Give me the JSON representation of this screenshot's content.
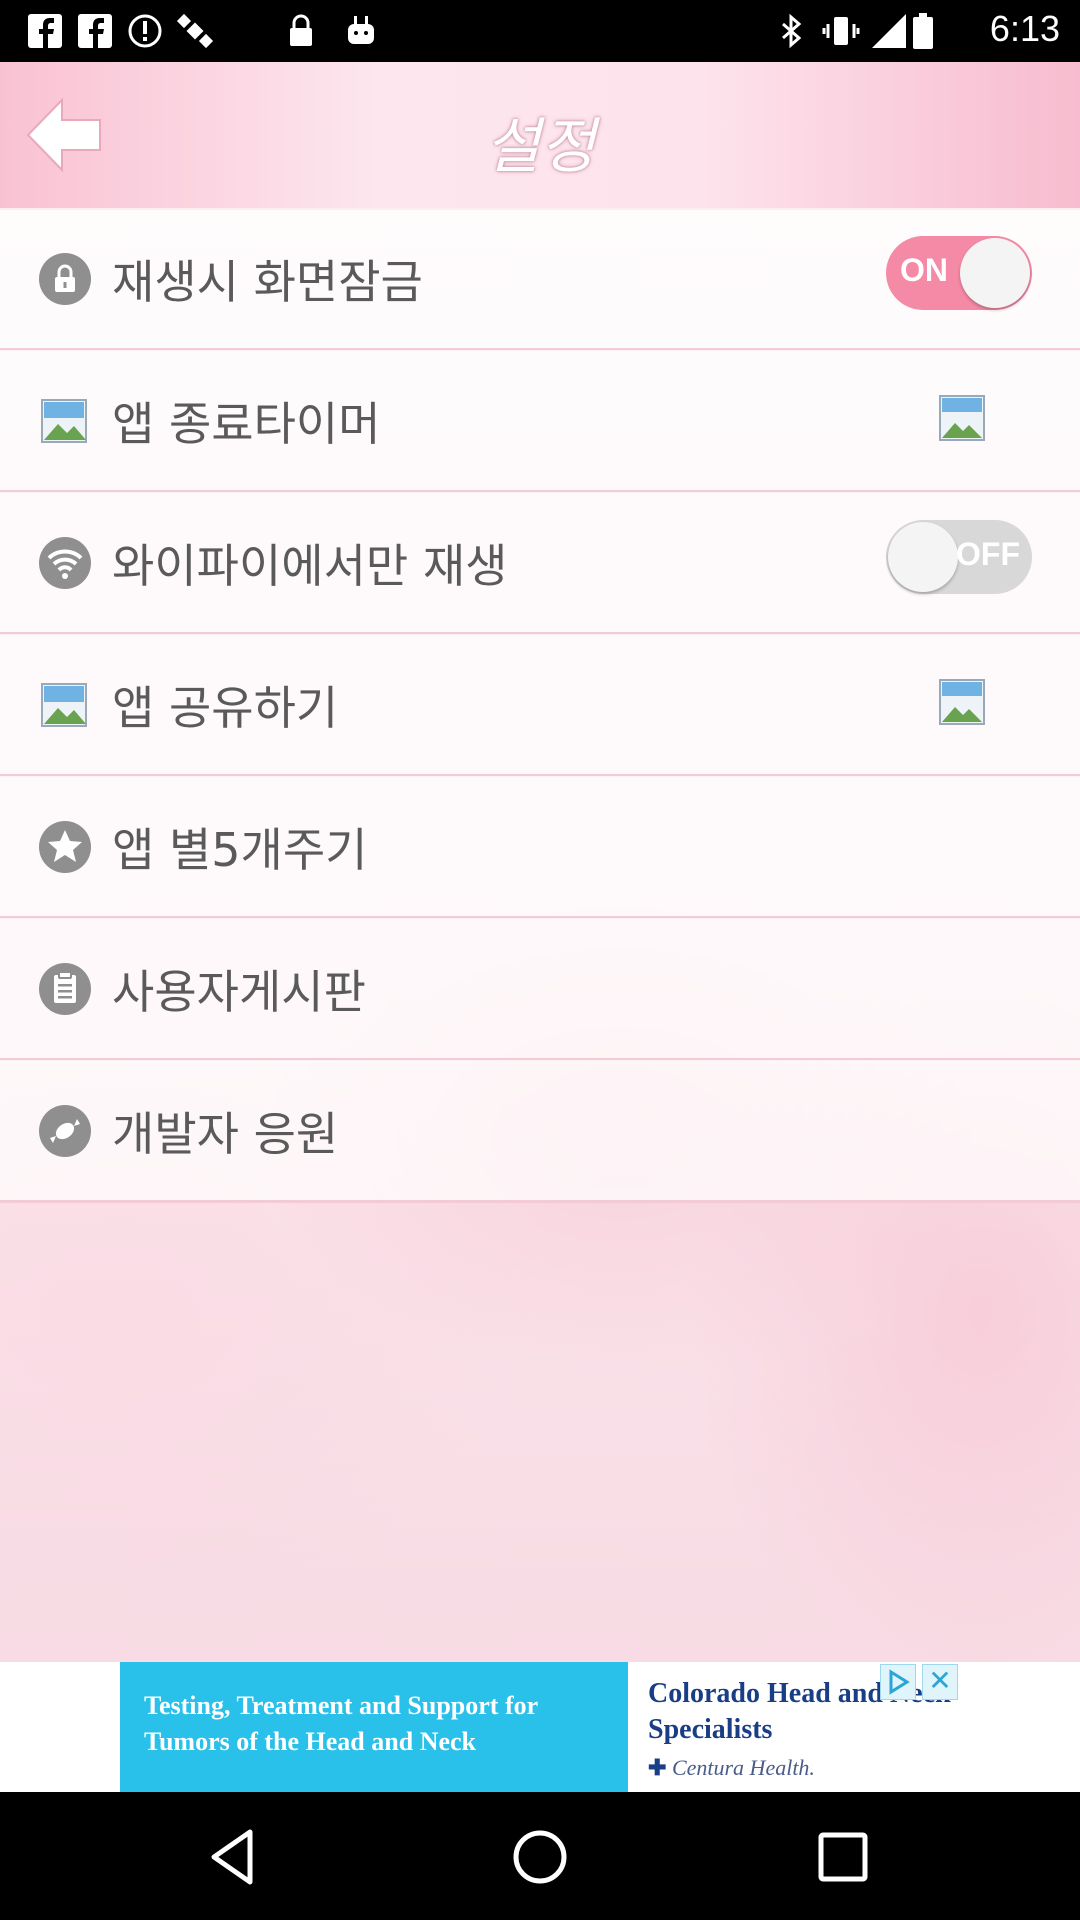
{
  "status_bar": {
    "time": "6:13",
    "left_icons": [
      "facebook-icon",
      "facebook-icon",
      "alert-icon",
      "satellite-icon",
      "lock-icon",
      "android-icon"
    ],
    "right_icons": [
      "bluetooth-icon",
      "vibrate-icon",
      "signal-icon",
      "battery-icon"
    ]
  },
  "header": {
    "title": "설정",
    "back_icon": "back-arrow-icon"
  },
  "settings": [
    {
      "label": "재생시 화면잠금",
      "icon": "lock-icon",
      "control": "toggle",
      "state": "ON"
    },
    {
      "label": "앱 종료타이머",
      "icon": "broken-image-icon",
      "control": "image"
    },
    {
      "label": "와이파이에서만 재생",
      "icon": "wifi-icon",
      "control": "toggle",
      "state": "OFF"
    },
    {
      "label": "앱 공유하기",
      "icon": "broken-image-icon",
      "control": "image"
    },
    {
      "label": "앱 별5개주기",
      "icon": "star-icon"
    },
    {
      "label": "사용자게시판",
      "icon": "clipboard-icon"
    },
    {
      "label": "개발자 응원",
      "icon": "candy-icon"
    }
  ],
  "ad": {
    "left_text": "Testing, Treatment and Support for Tumors of the Head and Neck",
    "right_text": "Colorado Head and Neck Specialists",
    "brand": "Centura Health."
  },
  "colors": {
    "accent_pink": "#f58aa6",
    "header_pink": "#f9c2d3",
    "ad_blue": "#29c0ea"
  }
}
